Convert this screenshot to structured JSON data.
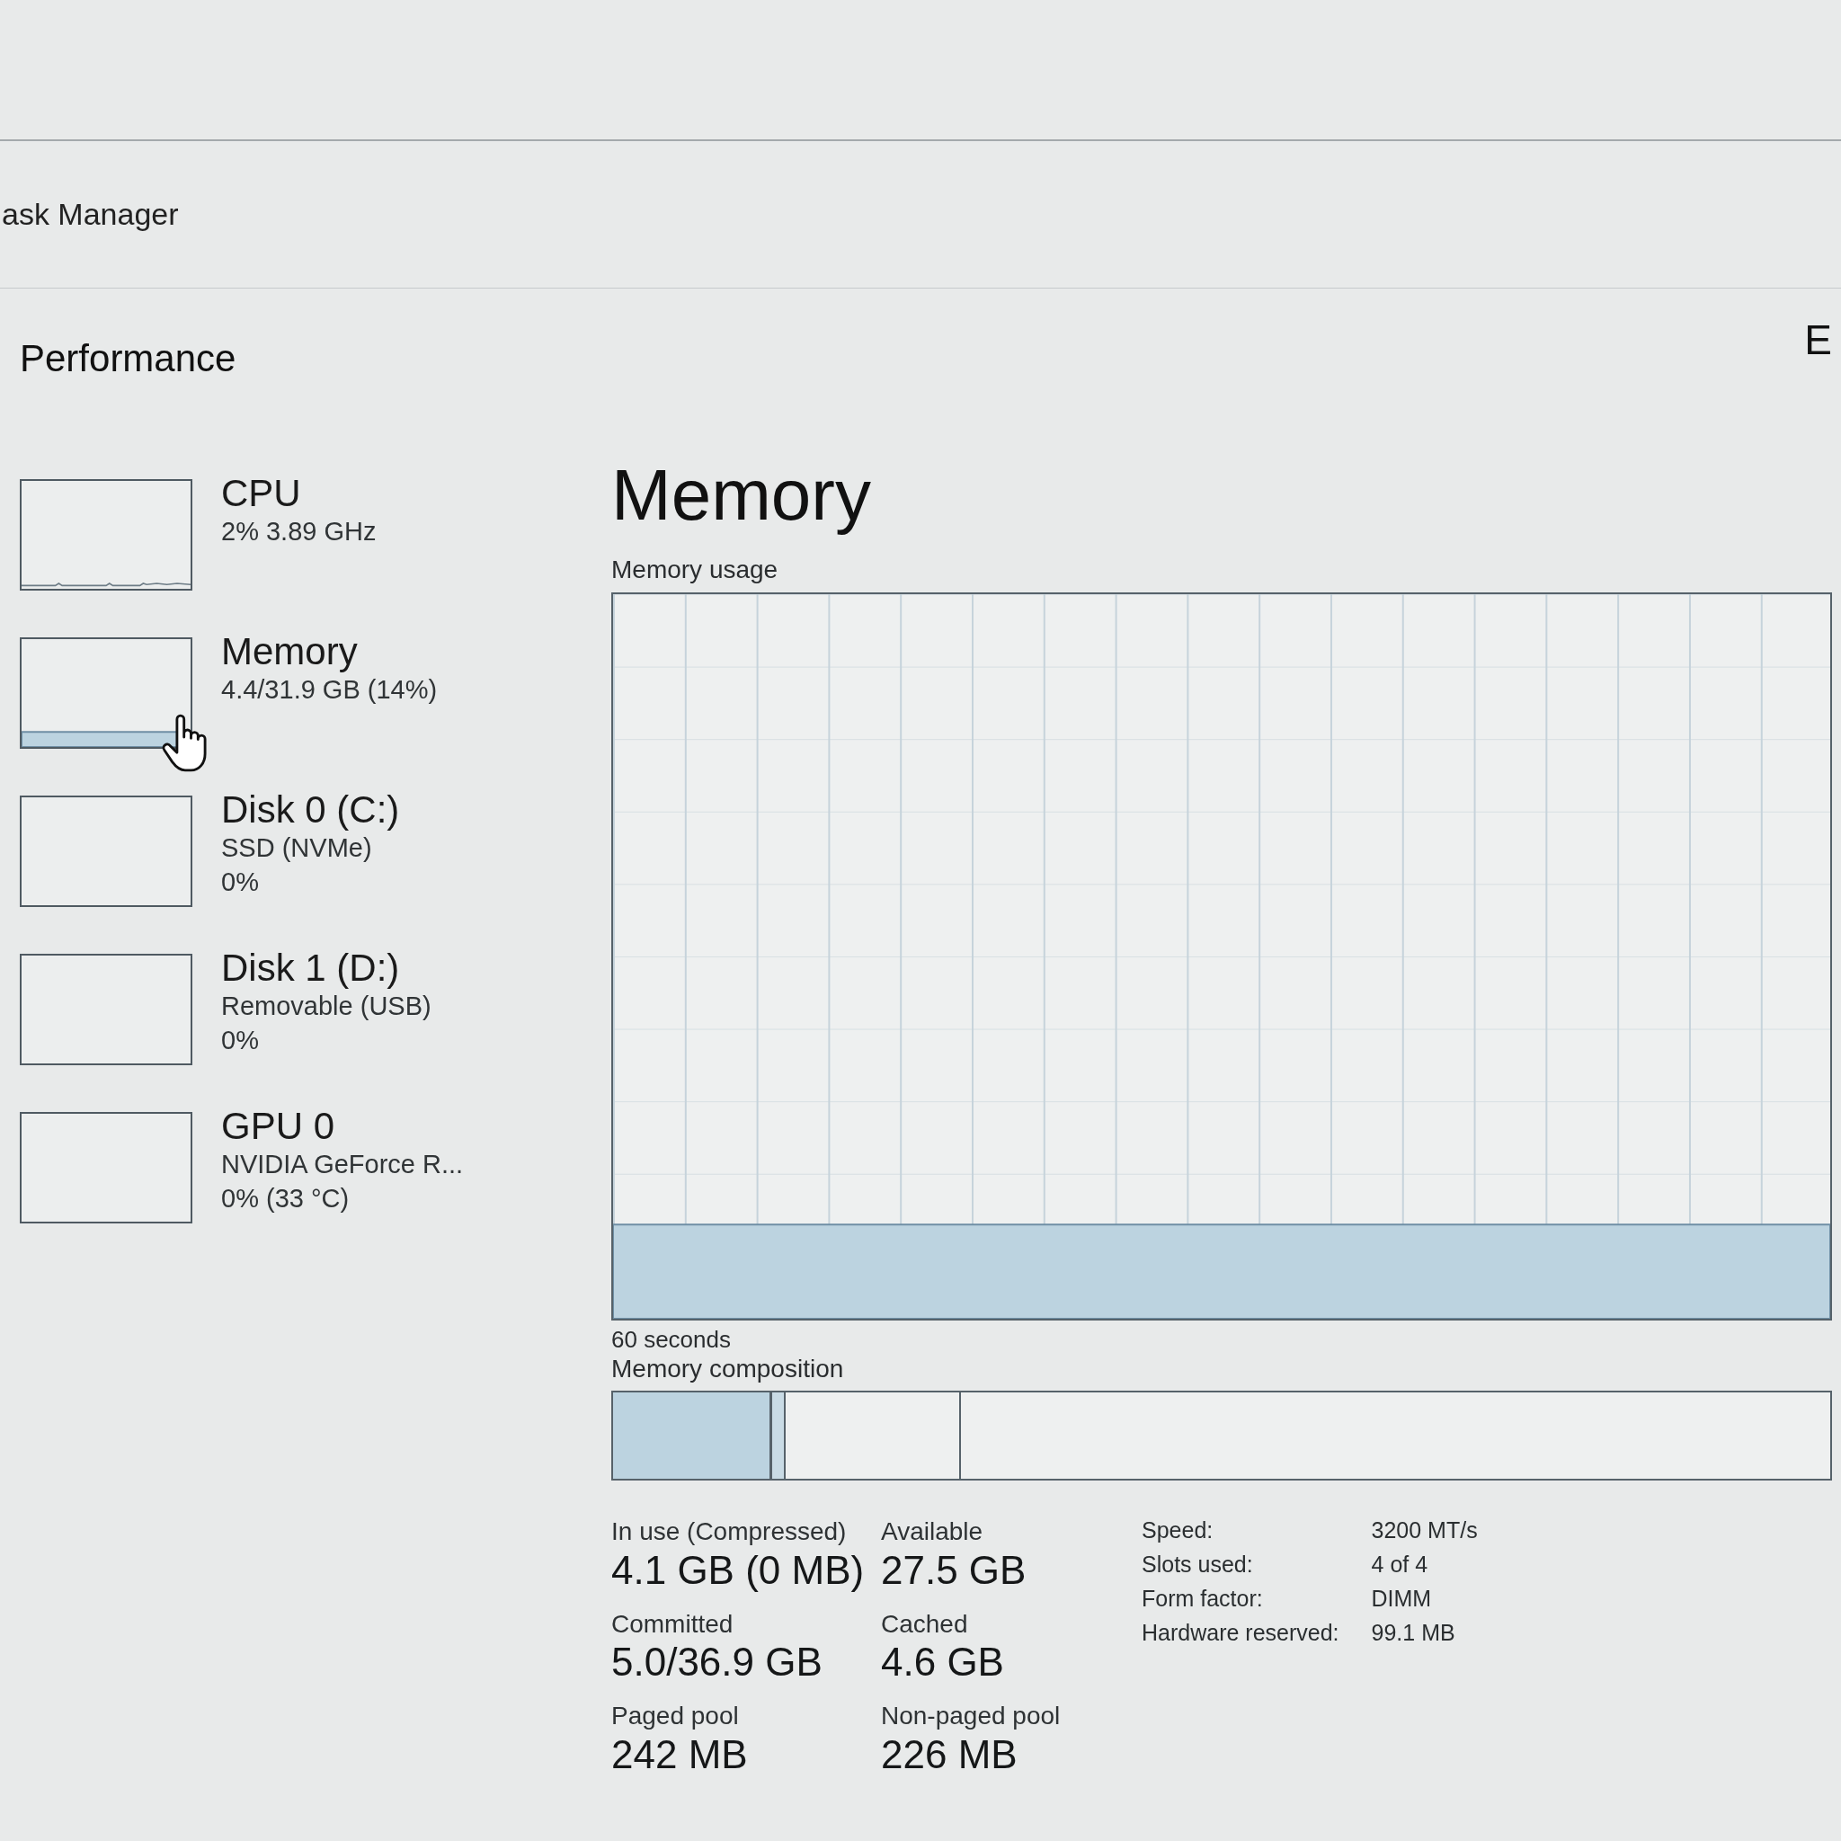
{
  "window": {
    "title": "ask Manager"
  },
  "page_header": {
    "title": "Performance",
    "right_text": "E"
  },
  "sidebar": {
    "items": [
      {
        "kind": "cpu",
        "name": "CPU",
        "details": [
          "2% 3.89 GHz"
        ],
        "hovered": false
      },
      {
        "kind": "memory",
        "name": "Memory",
        "details": [
          "4.4/31.9 GB (14%)"
        ],
        "hovered": true
      },
      {
        "kind": "disk",
        "name": "Disk 0 (C:)",
        "details": [
          "SSD (NVMe)",
          "0%"
        ],
        "hovered": false
      },
      {
        "kind": "disk",
        "name": "Disk 1 (D:)",
        "details": [
          "Removable (USB)",
          "0%"
        ],
        "hovered": false
      },
      {
        "kind": "gpu",
        "name": "GPU 0",
        "details": [
          "NVIDIA GeForce R...",
          "0% (33 °C)"
        ],
        "hovered": false
      }
    ]
  },
  "detail": {
    "title": "Memory",
    "usage_graph": {
      "label": "Memory usage",
      "time_label": "60 seconds"
    },
    "composition": {
      "label": "Memory composition",
      "segments": [
        {
          "kind": "in_use",
          "level": 0.13
        },
        {
          "kind": "modified",
          "level": 0.012
        },
        {
          "kind": "standby",
          "level": 0.144
        }
      ]
    },
    "stats": [
      {
        "label": "In use (Compressed)",
        "value": "4.1 GB (0 MB)"
      },
      {
        "label": "Available",
        "value": "27.5 GB"
      },
      {
        "label": "Committed",
        "value": "5.0/36.9 GB"
      },
      {
        "label": "Cached",
        "value": "4.6 GB"
      },
      {
        "label": "Paged pool",
        "value": "242 MB"
      },
      {
        "label": "Non-paged pool",
        "value": "226 MB"
      }
    ],
    "specs": [
      {
        "label": "Speed:",
        "value": "3200 MT/s"
      },
      {
        "label": "Slots used:",
        "value": "4 of 4"
      },
      {
        "label": "Form factor:",
        "value": "DIMM"
      },
      {
        "label": "Hardware reserved:",
        "value": "99.1 MB"
      }
    ]
  }
}
